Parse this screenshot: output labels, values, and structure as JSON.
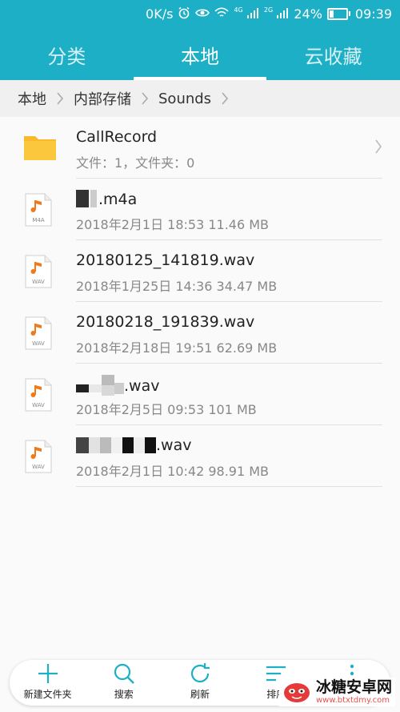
{
  "status_bar": {
    "speed": "0K/s",
    "net1": "4G",
    "net2": "2G",
    "battery": "24%",
    "time": "09:39"
  },
  "tabs": [
    {
      "label": "分类",
      "active": false
    },
    {
      "label": "本地",
      "active": true
    },
    {
      "label": "云收藏",
      "active": false
    }
  ],
  "breadcrumb": [
    "本地",
    "内部存储",
    "Sounds"
  ],
  "files": [
    {
      "name": "CallRecord",
      "meta": "文件：1，文件夹：0",
      "type": "folder",
      "badge": ""
    },
    {
      "name": ".m4a",
      "meta": "2018年2月1日 18:53 11.46 MB",
      "type": "audio",
      "badge": "M4A"
    },
    {
      "name": "20180125_141819.wav",
      "meta": "2018年1月25日 14:36 34.47 MB",
      "type": "audio",
      "badge": "WAV"
    },
    {
      "name": "20180218_191839.wav",
      "meta": "2018年2月18日 19:51 62.69 MB",
      "type": "audio",
      "badge": "WAV"
    },
    {
      "name": ".wav",
      "meta": "2018年2月5日 09:53 101 MB",
      "type": "audio",
      "badge": "WAV"
    },
    {
      "name": ".wav",
      "meta": "2018年2月1日 10:42 98.91 MB",
      "type": "audio",
      "badge": "WAV"
    }
  ],
  "actions": [
    {
      "label": "新建文件夹",
      "icon": "plus-icon"
    },
    {
      "label": "搜索",
      "icon": "search-icon"
    },
    {
      "label": "刷新",
      "icon": "refresh-icon"
    },
    {
      "label": "排序",
      "icon": "sort-icon"
    },
    {
      "label": "",
      "icon": "more-icon"
    }
  ],
  "watermark": {
    "text": "冰糖安卓网",
    "url": "www.btxtdmy.com"
  },
  "colors": {
    "header": "#1dafc5",
    "folder": "#f9b92a",
    "audio_note": "#f07a1a"
  }
}
